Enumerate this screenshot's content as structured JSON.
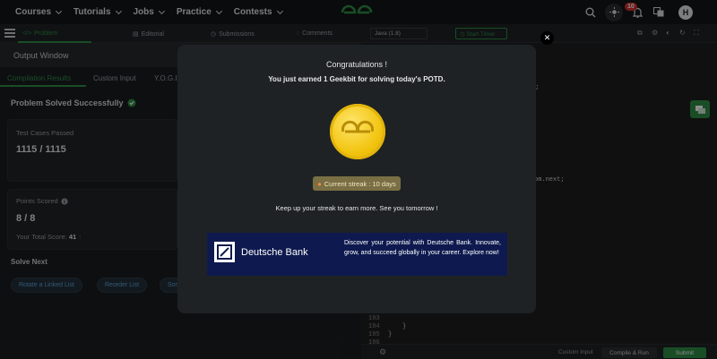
{
  "nav": {
    "menu": [
      "Courses",
      "Tutorials",
      "Jobs",
      "Practice",
      "Contests"
    ],
    "notification_count": "10",
    "avatar_initial": "H"
  },
  "problem_tabs": [
    "Problem",
    "Editorial",
    "Submissions",
    "Comments"
  ],
  "output": {
    "window_title": "Output Window",
    "tabs": [
      "Compilation Results",
      "Custom Input",
      "Y.O.G.I."
    ],
    "status": "Problem Solved Successfully",
    "test_cases_label": "Test Cases Passed",
    "test_cases_value": "1115 / 1115",
    "points_label": "Points Scored",
    "points_value": "8 / 8",
    "total_score_label": "Your Total Score:",
    "total_score_value": "41",
    "solve_next_label": "Solve Next",
    "solve_next": [
      "Rotate a Linked List",
      "Reorder List",
      "Sort"
    ]
  },
  "editor": {
    "language": "Java (1.8)",
    "start_timer": "Start Timer",
    "code_fragments": [
      ");",
      "om.next;"
    ],
    "line_numbers": [
      "193",
      "194",
      "195",
      "196"
    ],
    "tail_lines": [
      "}",
      "}",
      ""
    ],
    "custom_input": "Custom Input",
    "compile_run": "Compile & Run",
    "submit": "Submit"
  },
  "modal": {
    "title": "Congratulations !",
    "subtitle": "You just earned 1 Geekbit for solving today's POTD.",
    "streak": "Current streak : 10 days",
    "keep_up": "Keep up your streak to earn more. See you tomorrow !",
    "ad": {
      "brand": "Deutsche Bank",
      "text": "Discover your potential with Deutsche Bank. Innovate, grow, and succeed globally in your career. Explore now!"
    }
  },
  "colors": {
    "accent_green": "#2f8d46",
    "coin_gold": "#f2c40f",
    "ad_navy": "#0e1a4f"
  }
}
